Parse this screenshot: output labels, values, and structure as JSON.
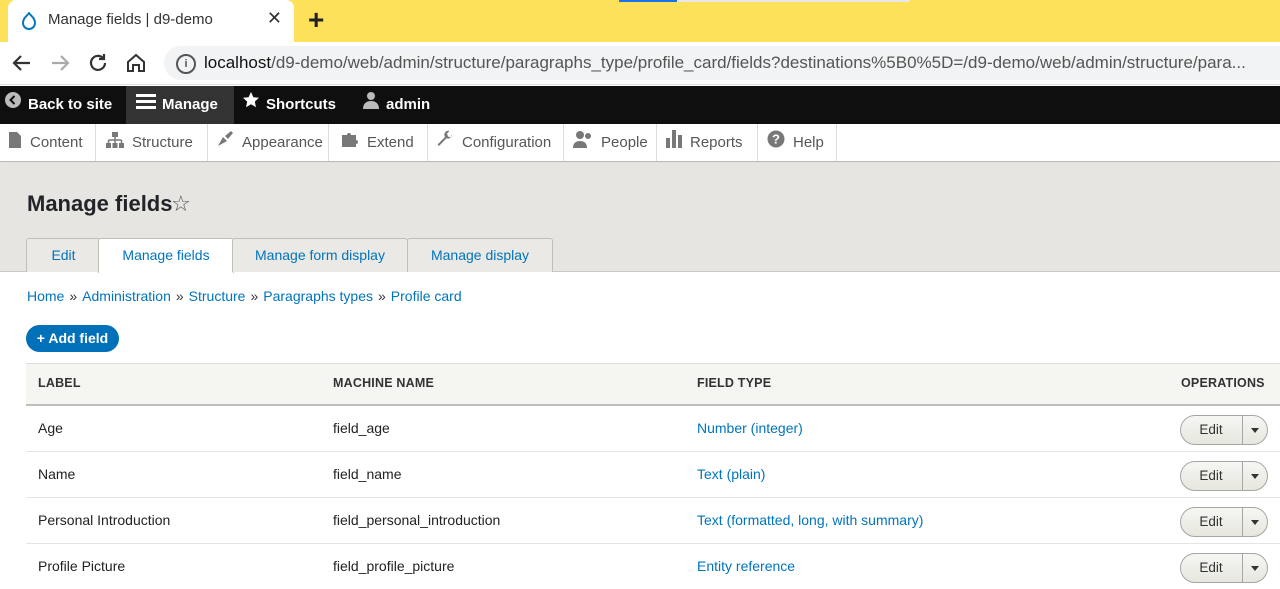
{
  "browser": {
    "tab_title": "Manage fields | d9-demo",
    "url_host": "localhost",
    "url_path": "/d9-demo/web/admin/structure/paragraphs_type/profile_card/fields?destinations%5B0%5D=/d9-demo/web/admin/structure/para...",
    "colors": {
      "tabbar": "#fde15a"
    }
  },
  "toolbar": {
    "back_label": "Back to site",
    "manage_label": "Manage",
    "shortcuts_label": "Shortcuts",
    "user_label": "admin"
  },
  "tray": {
    "items": [
      {
        "label": "Content",
        "icon": "file-icon"
      },
      {
        "label": "Structure",
        "icon": "sitemap-icon"
      },
      {
        "label": "Appearance",
        "icon": "brush-icon"
      },
      {
        "label": "Extend",
        "icon": "puzzle-icon"
      },
      {
        "label": "Configuration",
        "icon": "wrench-icon"
      },
      {
        "label": "People",
        "icon": "people-icon"
      },
      {
        "label": "Reports",
        "icon": "bar-chart-icon"
      },
      {
        "label": "Help",
        "icon": "help-icon"
      }
    ]
  },
  "page": {
    "title": "Manage fields",
    "tabs": [
      "Edit",
      "Manage fields",
      "Manage form display",
      "Manage display"
    ],
    "active_tab": "Manage fields",
    "breadcrumb": [
      "Home",
      "Administration",
      "Structure",
      "Paragraphs types",
      "Profile card"
    ],
    "breadcrumb_sep": "»",
    "add_field_label": "+ Add field"
  },
  "table": {
    "headers": [
      "LABEL",
      "MACHINE NAME",
      "FIELD TYPE",
      "OPERATIONS"
    ],
    "rows": [
      {
        "label": "Age",
        "machine": "field_age",
        "type": "Number (integer)",
        "op": "Edit"
      },
      {
        "label": "Name",
        "machine": "field_name",
        "type": "Text (plain)",
        "op": "Edit"
      },
      {
        "label": "Personal Introduction",
        "machine": "field_personal_introduction",
        "type": "Text (formatted, long, with summary)",
        "op": "Edit"
      },
      {
        "label": "Profile Picture",
        "machine": "field_profile_picture",
        "type": "Entity reference",
        "op": "Edit"
      }
    ]
  }
}
